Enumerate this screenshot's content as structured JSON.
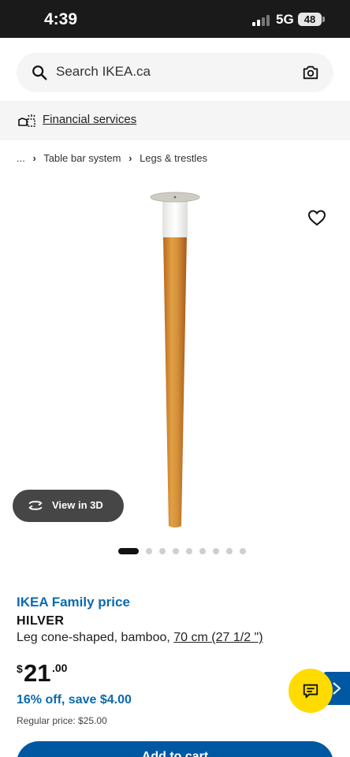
{
  "status_bar": {
    "time": "4:39",
    "network": "5G",
    "battery": "48"
  },
  "search": {
    "placeholder": "Search IKEA.ca"
  },
  "financial": {
    "link": "Financial services"
  },
  "breadcrumb": {
    "ellipsis": "...",
    "items": [
      "Table bar system",
      "Legs & trestles"
    ]
  },
  "view_3d": {
    "label": "View in 3D"
  },
  "carousel": {
    "total": 9,
    "active_index": 0
  },
  "product": {
    "family_label": "IKEA Family price",
    "name": "HILVER",
    "description": "Leg cone-shaped, bamboo, ",
    "size": "70 cm (27 1/2 \")",
    "currency": "$",
    "price_whole": "21",
    "price_decimal": ".00",
    "discount": "16% off, save $4.00",
    "regular_price": "Regular price: $25.00"
  },
  "cart": {
    "label": "Add to cart"
  },
  "colors": {
    "ikea_blue": "#0058a3",
    "link_blue": "#0a6ab0",
    "chat_yellow": "#ffdb00"
  },
  "icons": [
    "search-icon",
    "camera-icon",
    "financial-icon",
    "chevron-icon",
    "heart-icon",
    "rotate-3d-icon",
    "chat-icon",
    "arrow-right-icon"
  ]
}
